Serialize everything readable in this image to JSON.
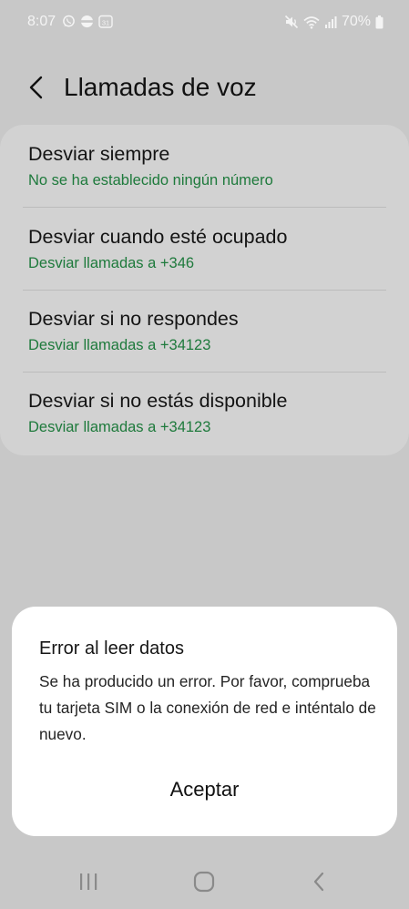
{
  "status_bar": {
    "time": "8:07",
    "left_icons": [
      "whatsapp-icon",
      "pie-app-icon",
      "calendar-31-icon"
    ],
    "calendar_day": "31",
    "battery": "70%",
    "right_icons": [
      "mute-vibrate-icon",
      "wifi-icon",
      "signal-icon",
      "battery-icon"
    ]
  },
  "header": {
    "title": "Llamadas de voz",
    "back_icon": "chevron-left-icon"
  },
  "settings": {
    "items": [
      {
        "title": "Desviar siempre",
        "subtitle": "No se ha establecido ningún número"
      },
      {
        "title": "Desviar cuando esté ocupado",
        "subtitle": "Desviar llamadas a +346"
      },
      {
        "title": "Desviar si no respondes",
        "subtitle": "Desviar llamadas a +34123"
      },
      {
        "title": "Desviar si no estás disponible",
        "subtitle": "Desviar llamadas a +34123"
      }
    ]
  },
  "dialog": {
    "title": "Error al leer datos",
    "message": "Se ha producido un error. Por favor, comprueba tu tarjeta SIM o la conexión de red e inténtalo de nuevo.",
    "button": "Aceptar"
  },
  "nav_bar": {
    "buttons": [
      "recent-apps-icon",
      "home-icon",
      "back-icon"
    ]
  },
  "colors": {
    "background": "#c8c8c8",
    "card": "#d2d2d2",
    "accent_green": "#1e7a3c",
    "dialog": "#ffffff"
  }
}
